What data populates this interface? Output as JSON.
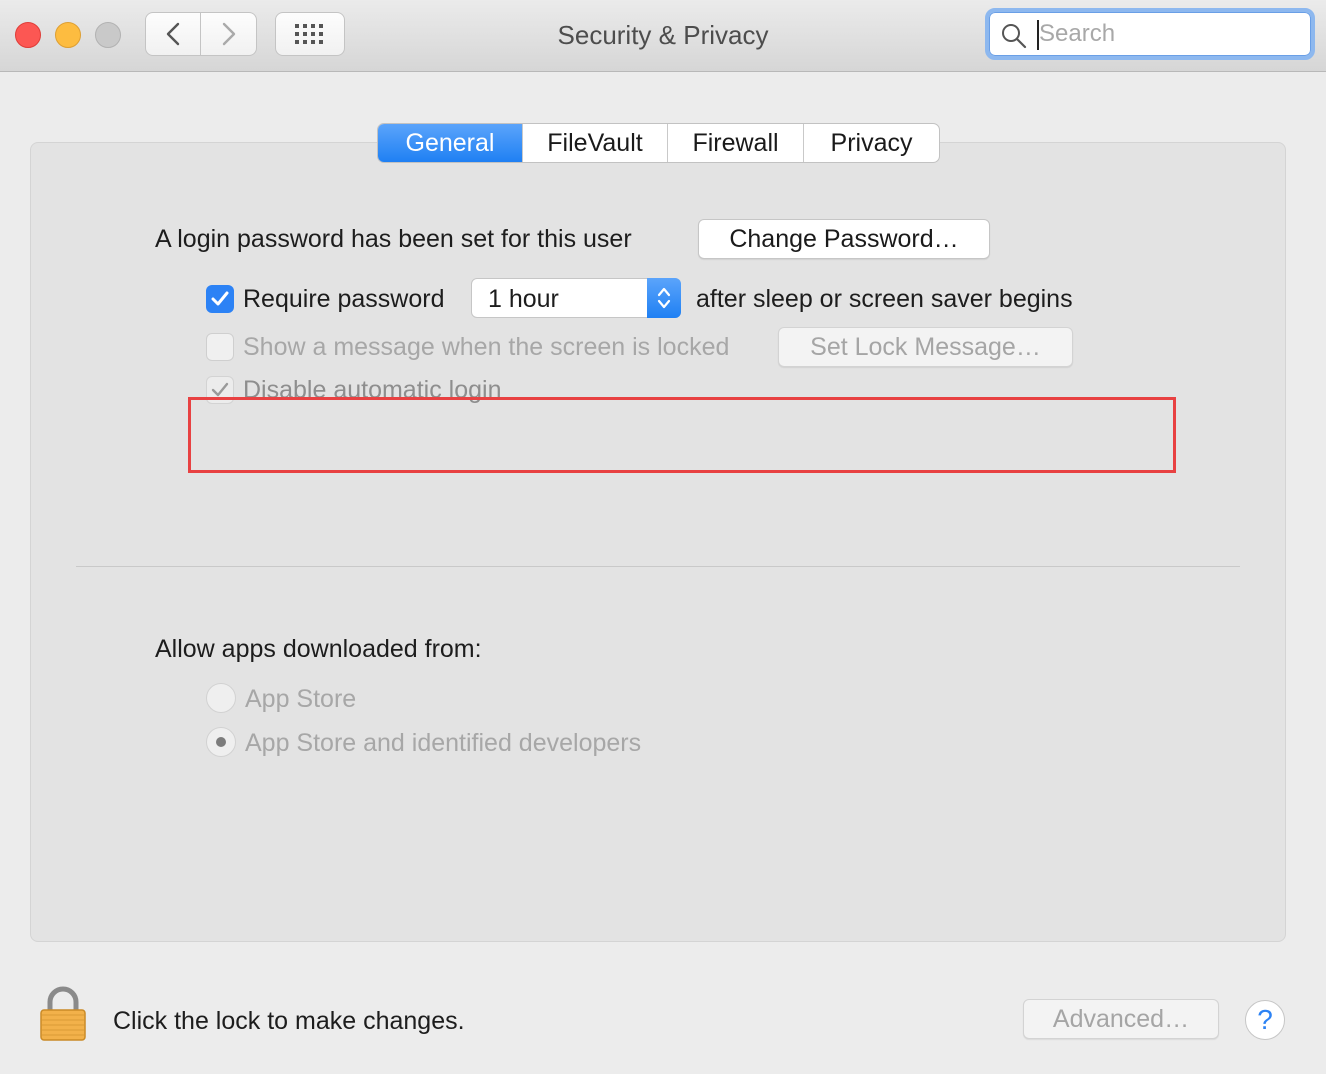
{
  "window": {
    "title": "Security & Privacy",
    "traffic_lights": [
      "close",
      "minimize",
      "zoom"
    ],
    "search_placeholder": "Search"
  },
  "tabs": [
    {
      "label": "General",
      "active": true
    },
    {
      "label": "FileVault",
      "active": false
    },
    {
      "label": "Firewall",
      "active": false
    },
    {
      "label": "Privacy",
      "active": false
    }
  ],
  "general": {
    "login_text": "A login password has been set for this user",
    "change_password_label": "Change Password…",
    "require_password_label": "Require password",
    "require_password_checked": true,
    "require_password_value": "1 hour",
    "after_sleep_text": "after sleep or screen saver begins",
    "show_message_label": "Show a message when the screen is locked",
    "show_message_checked": false,
    "set_lock_message_label": "Set Lock Message…",
    "disable_auto_login_label": "Disable automatic login",
    "disable_auto_login_checked": true
  },
  "apps": {
    "heading": "Allow apps downloaded from:",
    "options": [
      {
        "label": "App Store",
        "selected": false
      },
      {
        "label": "App Store and identified developers",
        "selected": true
      }
    ]
  },
  "footer": {
    "lock_text": "Click the lock to make changes.",
    "advanced_label": "Advanced…",
    "help_label": "?"
  },
  "colors": {
    "accent": "#1f80f3",
    "highlight_border": "#e84142",
    "close": "#fc5753",
    "minimize": "#fdbc40",
    "zoom_disabled": "#c9c9c9"
  }
}
